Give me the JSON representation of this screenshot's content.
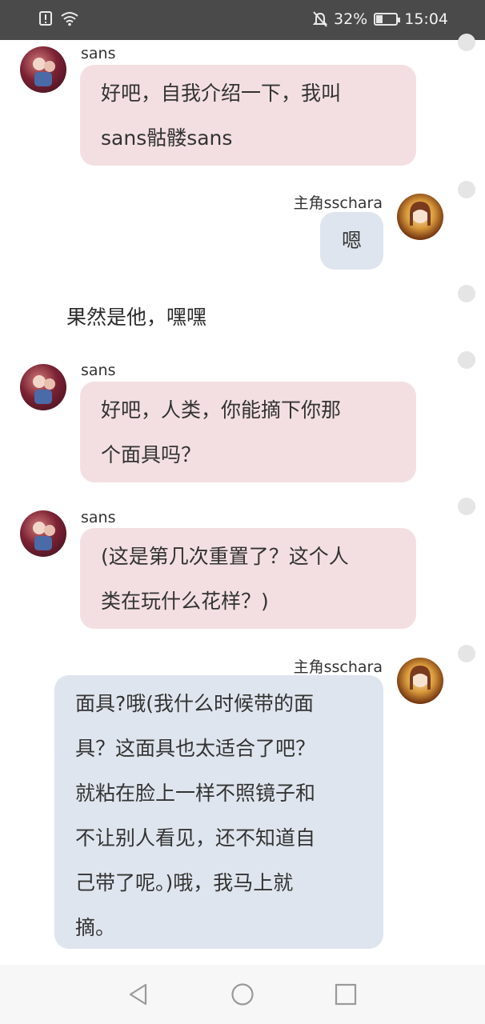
{
  "status_bar": {
    "battery_percent": "32%",
    "time": "15:04",
    "battery_level": 0.32
  },
  "messages": [
    {
      "sender": "sans",
      "avatar_icon": "sans-avatar",
      "text_lines": [
        "好吧，自我介绍一下，我叫",
        "sans骷髅sans"
      ]
    },
    {
      "sender": "主角sschara",
      "avatar_icon": "chara-avatar",
      "text_lines": [
        "嗯"
      ]
    },
    {
      "narration": "果然是他，嘿嘿"
    },
    {
      "sender": "sans",
      "avatar_icon": "sans-avatar",
      "text_lines": [
        "好吧，人类，你能摘下你那",
        "个面具吗？"
      ]
    },
    {
      "sender": "sans",
      "avatar_icon": "sans-avatar",
      "text_lines": [
        "(这是第几次重置了？这个人",
        "类在玩什么花样？)"
      ]
    },
    {
      "sender": "主角sschara",
      "avatar_icon": "chara-avatar",
      "text_lines": [
        "面具?哦(我什么时候带的面",
        "具？这面具也太适合了吧？",
        "就粘在脸上一样不照镜子和",
        "不让别人看见，还不知道自",
        "己带了呢。)哦，我马上就",
        "摘。"
      ]
    }
  ],
  "nav_bar": {
    "back_icon": "back-triangle-icon",
    "home_icon": "home-circle-icon",
    "recents_icon": "recents-square-icon"
  },
  "colors": {
    "status_bar_bg": "#4a4a4a",
    "sans_bubble": "#f3dfe1",
    "chara_bubble": "#dfe5ee",
    "nav_bar_bg": "#f7f7f7"
  }
}
